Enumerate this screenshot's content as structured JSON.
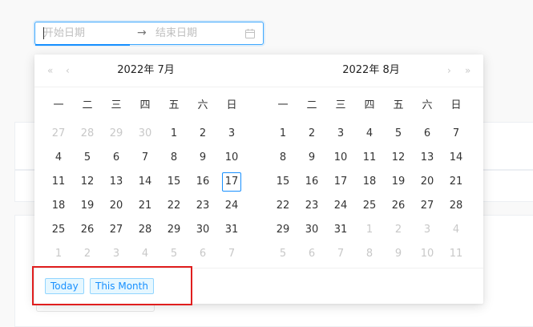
{
  "range_input": {
    "start_placeholder": "开始日期",
    "end_placeholder": "结束日期",
    "separator_icon": "arrow-right-icon",
    "suffix_icon": "calendar-icon"
  },
  "left_panel": {
    "year": "2022年",
    "month": "7月",
    "nav": {
      "super_prev": "«",
      "prev": "‹"
    },
    "weekdays": [
      "一",
      "二",
      "三",
      "四",
      "五",
      "六",
      "日"
    ],
    "days": [
      {
        "d": "27",
        "out": true
      },
      {
        "d": "28",
        "out": true
      },
      {
        "d": "29",
        "out": true
      },
      {
        "d": "30",
        "out": true
      },
      {
        "d": "1"
      },
      {
        "d": "2"
      },
      {
        "d": "3"
      },
      {
        "d": "4"
      },
      {
        "d": "5"
      },
      {
        "d": "6"
      },
      {
        "d": "7"
      },
      {
        "d": "8"
      },
      {
        "d": "9"
      },
      {
        "d": "10"
      },
      {
        "d": "11"
      },
      {
        "d": "12"
      },
      {
        "d": "13"
      },
      {
        "d": "14"
      },
      {
        "d": "15"
      },
      {
        "d": "16"
      },
      {
        "d": "17",
        "today": true
      },
      {
        "d": "18"
      },
      {
        "d": "19"
      },
      {
        "d": "20"
      },
      {
        "d": "21"
      },
      {
        "d": "22"
      },
      {
        "d": "23"
      },
      {
        "d": "24"
      },
      {
        "d": "25"
      },
      {
        "d": "26"
      },
      {
        "d": "27"
      },
      {
        "d": "28"
      },
      {
        "d": "29"
      },
      {
        "d": "30"
      },
      {
        "d": "31"
      },
      {
        "d": "1",
        "out": true
      },
      {
        "d": "2",
        "out": true
      },
      {
        "d": "3",
        "out": true
      },
      {
        "d": "4",
        "out": true
      },
      {
        "d": "5",
        "out": true
      },
      {
        "d": "6",
        "out": true
      },
      {
        "d": "7",
        "out": true
      }
    ]
  },
  "right_panel": {
    "year": "2022年",
    "month": "8月",
    "nav": {
      "next": "›",
      "super_next": "»"
    },
    "weekdays": [
      "一",
      "二",
      "三",
      "四",
      "五",
      "六",
      "日"
    ],
    "days": [
      {
        "d": "1"
      },
      {
        "d": "2"
      },
      {
        "d": "3"
      },
      {
        "d": "4"
      },
      {
        "d": "5"
      },
      {
        "d": "6"
      },
      {
        "d": "7"
      },
      {
        "d": "8"
      },
      {
        "d": "9"
      },
      {
        "d": "10"
      },
      {
        "d": "11"
      },
      {
        "d": "12"
      },
      {
        "d": "13"
      },
      {
        "d": "14"
      },
      {
        "d": "15"
      },
      {
        "d": "16"
      },
      {
        "d": "17"
      },
      {
        "d": "18"
      },
      {
        "d": "19"
      },
      {
        "d": "20"
      },
      {
        "d": "21"
      },
      {
        "d": "22"
      },
      {
        "d": "23"
      },
      {
        "d": "24"
      },
      {
        "d": "25"
      },
      {
        "d": "26"
      },
      {
        "d": "27"
      },
      {
        "d": "28"
      },
      {
        "d": "29"
      },
      {
        "d": "30"
      },
      {
        "d": "31"
      },
      {
        "d": "1",
        "out": true
      },
      {
        "d": "2",
        "out": true
      },
      {
        "d": "3",
        "out": true
      },
      {
        "d": "4",
        "out": true
      },
      {
        "d": "5",
        "out": true
      },
      {
        "d": "6",
        "out": true
      },
      {
        "d": "7",
        "out": true
      },
      {
        "d": "8",
        "out": true
      },
      {
        "d": "9",
        "out": true
      },
      {
        "d": "10",
        "out": true
      },
      {
        "d": "11",
        "out": true
      }
    ]
  },
  "footer": {
    "presets": [
      "Today",
      "This Month"
    ]
  },
  "colors": {
    "accent": "#1890ff",
    "highlight": "#e01e1e"
  }
}
